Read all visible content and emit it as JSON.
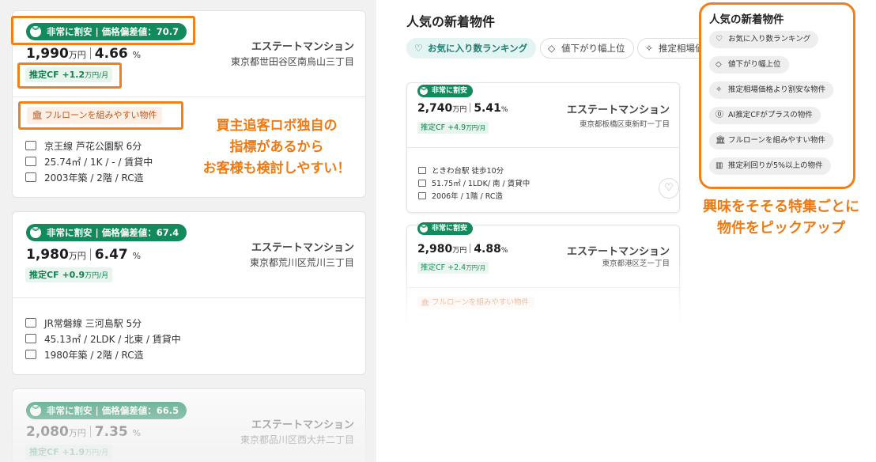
{
  "left_cards": [
    {
      "badge": "非常に割安 | 価格偏差値：70.7",
      "price": "1,990",
      "price_unit": "万円",
      "yield": "4.66",
      "yield_unit": "%",
      "cf_label": "推定CF",
      "cf_value": "+1.2",
      "cf_unit": "万円/月",
      "name": "エステートマンション",
      "address": "東京都世田谷区南烏山三丁目",
      "loan_tag": "フルローンを組みやすい物件",
      "station": "京王線 芦花公園駅 6分",
      "layout": "25.74㎡ / 1K / - / 賃貸中",
      "building": "2003年築 / 2階 / RC造"
    },
    {
      "badge": "非常に割安 | 価格偏差値：67.4",
      "price": "1,980",
      "price_unit": "万円",
      "yield": "6.47",
      "yield_unit": "%",
      "cf_label": "推定CF",
      "cf_value": "+0.9",
      "cf_unit": "万円/月",
      "name": "エステートマンション",
      "address": "東京都荒川区荒川三丁目",
      "station": "JR常磐線 三河島駅 5分",
      "layout": "45.13㎡ / 2LDK / 北東 / 賃貸中",
      "building": "1980年築 / 2階 / RC造"
    },
    {
      "badge": "非常に割安 | 価格偏差値：66.5",
      "price": "2,080",
      "price_unit": "万円",
      "yield": "7.35",
      "yield_unit": "%",
      "cf_label": "推定CF",
      "cf_value": "+1.9",
      "cf_unit": "万円/月",
      "name": "エステートマンション",
      "address": "東京都品川区西大井二丁目"
    }
  ],
  "annotation_left": [
    "買主追客ロボ独自の",
    "指標があるから",
    "お客様も検討しやすい！"
  ],
  "mid": {
    "title": "人気の新着物件",
    "chips": [
      "お気に入り数ランキング",
      "値下がり幅上位",
      "推定相場価"
    ],
    "cards": [
      {
        "badge": "非常に割安",
        "price": "2,740",
        "price_unit": "万円",
        "yield": "5.41",
        "yield_unit": "%",
        "cf": "推定CF +4.9",
        "cf_unit": "万円/月",
        "name": "エステートマンション",
        "address": "東京都板橋区東新町一丁目",
        "station": "ときわ台駅 徒歩10分",
        "layout": "51.75㎡ / 1LDK/ 南 / 賃貸中",
        "building": "2006年 / 1階 / RC造"
      },
      {
        "badge": "非常に割安",
        "price": "2,980",
        "price_unit": "万円",
        "yield": "4.88",
        "yield_unit": "%",
        "cf": "推定CF +2.4",
        "cf_unit": "万円/月",
        "name": "エステートマンション",
        "address": "東京都港区芝一丁目",
        "loan_tag": "フルローンを組みやすい物件"
      }
    ]
  },
  "right": {
    "title": "人気の新着物件",
    "chips": [
      {
        "icon": "heart-icon",
        "label": "お気に入り数ランキング"
      },
      {
        "icon": "tag-icon",
        "label": "値下がり幅上位"
      },
      {
        "icon": "sparkle-icon",
        "label": "推定相場価格より割安な物件"
      },
      {
        "icon": "yen-icon",
        "label": "AI推定CFがプラスの物件"
      },
      {
        "icon": "bank-icon",
        "label": "フルローンを組みやすい物件"
      },
      {
        "icon": "bar-chart-icon",
        "label": "推定利回りが5%以上の物件"
      }
    ]
  },
  "annotation_right": [
    "興味をそそる特集ごとに",
    "物件をピックアップ"
  ],
  "colors": {
    "accent": "#f0801a",
    "badge_green": "#138a5b",
    "cf_green": "#12804f",
    "annotation": "#ee7a13"
  }
}
